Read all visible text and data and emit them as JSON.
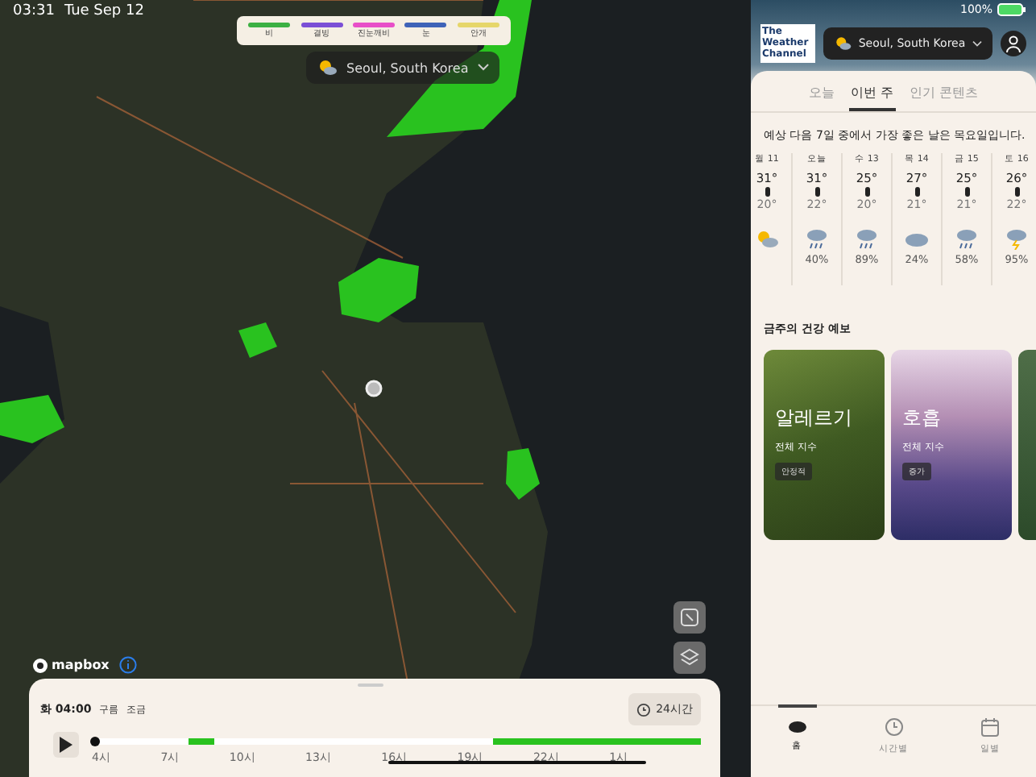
{
  "status_bar": {
    "time": "03:31",
    "date": "Tue Sep 12",
    "battery": "100%"
  },
  "map": {
    "legend": [
      {
        "label": "비",
        "color": "#3cb043"
      },
      {
        "label": "결빙",
        "color": "#7b4fd6"
      },
      {
        "label": "진눈깨비",
        "color": "#e84fc8"
      },
      {
        "label": "눈",
        "color": "#3f63b8"
      },
      {
        "label": "안개",
        "color": "#e6d66a"
      }
    ],
    "location": "Seoul, South Korea",
    "attribution": "mapbox"
  },
  "timeline": {
    "time": "화 04:00",
    "condition": "구름",
    "intensity": "조금",
    "range_button": "24시간",
    "level": 0.0,
    "ticks": [
      "4시",
      "7시",
      "10시",
      "13시",
      "16시",
      "19시",
      "22시",
      "1시"
    ]
  },
  "panel": {
    "logo": "The Weather Channel",
    "location": "Seoul, South Korea",
    "tabs": [
      {
        "label": "오늘",
        "selected": false
      },
      {
        "label": "이번 주",
        "selected": true
      },
      {
        "label": "인기 콘텐츠",
        "selected": false
      }
    ],
    "summary": "예상 다음 7일 중에서 가장 좋은 날은 목요일입니다.",
    "days": [
      {
        "day": "월 11",
        "high": "31°",
        "low": "20°",
        "kind": "sun-cloud"
      },
      {
        "day": "오늘",
        "high": "31°",
        "low": "22°",
        "kind": "rain",
        "precip": "40%"
      },
      {
        "day": "수 13",
        "high": "25°",
        "low": "20°",
        "kind": "rain",
        "precip": "89%"
      },
      {
        "day": "목 14",
        "high": "27°",
        "low": "21°",
        "kind": "cloud",
        "precip": "24%"
      },
      {
        "day": "금 15",
        "high": "25°",
        "low": "21°",
        "kind": "rain",
        "precip": "58%"
      },
      {
        "day": "토 16",
        "high": "26°",
        "low": "22°",
        "kind": "storm",
        "precip": "95%"
      }
    ],
    "health_title": "금주의 건강 예보",
    "health_cards": [
      {
        "title": "알레르기",
        "subtitle": "전체 지수",
        "badge": "안정적",
        "kind": "grass"
      },
      {
        "title": "호흡",
        "subtitle": "전체 지수",
        "badge": "증가",
        "kind": "mountain"
      },
      {
        "kind": "forest"
      }
    ],
    "nav": [
      {
        "label": "홈",
        "kind": "home",
        "selected": true
      },
      {
        "label": "시간별",
        "kind": "clock",
        "selected": false
      },
      {
        "label": "일별",
        "kind": "calendar",
        "selected": false
      }
    ]
  }
}
